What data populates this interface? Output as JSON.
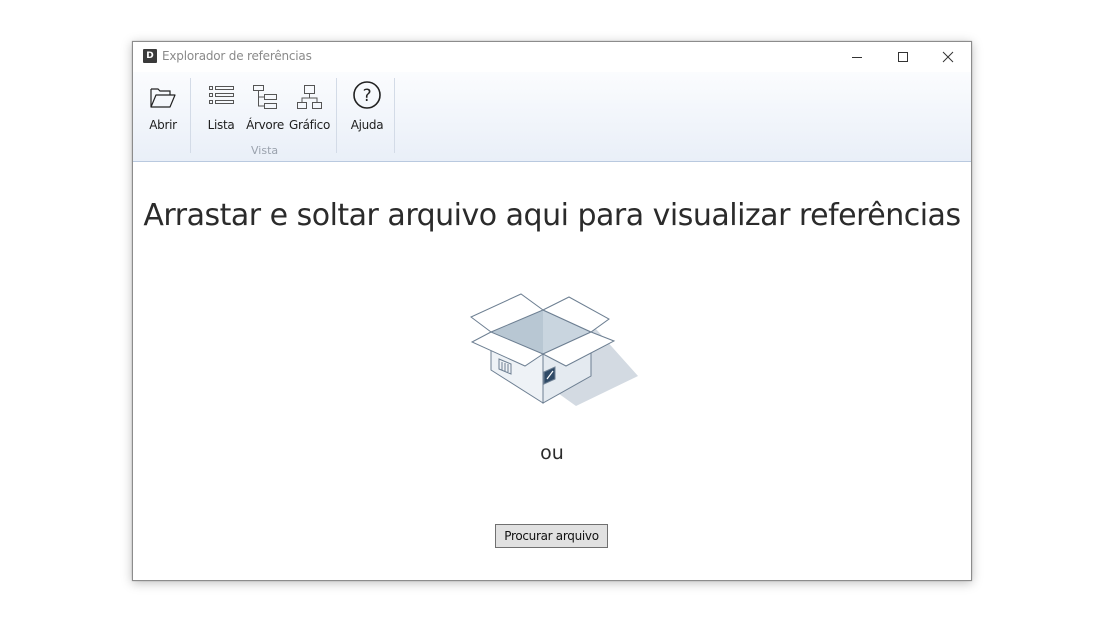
{
  "window": {
    "title": "Explorador de referências",
    "icon_letter": "D"
  },
  "ribbon": {
    "open_label": "Abrir",
    "list_label": "Lista",
    "tree_label": "Árvore",
    "graph_label": "Gráfico",
    "help_label": "Ajuda",
    "view_group_label": "Vista"
  },
  "main": {
    "drop_message": "Arrastar e soltar arquivo aqui para visualizar referências",
    "or_text": "ou",
    "browse_button": "Procurar arquivo"
  }
}
